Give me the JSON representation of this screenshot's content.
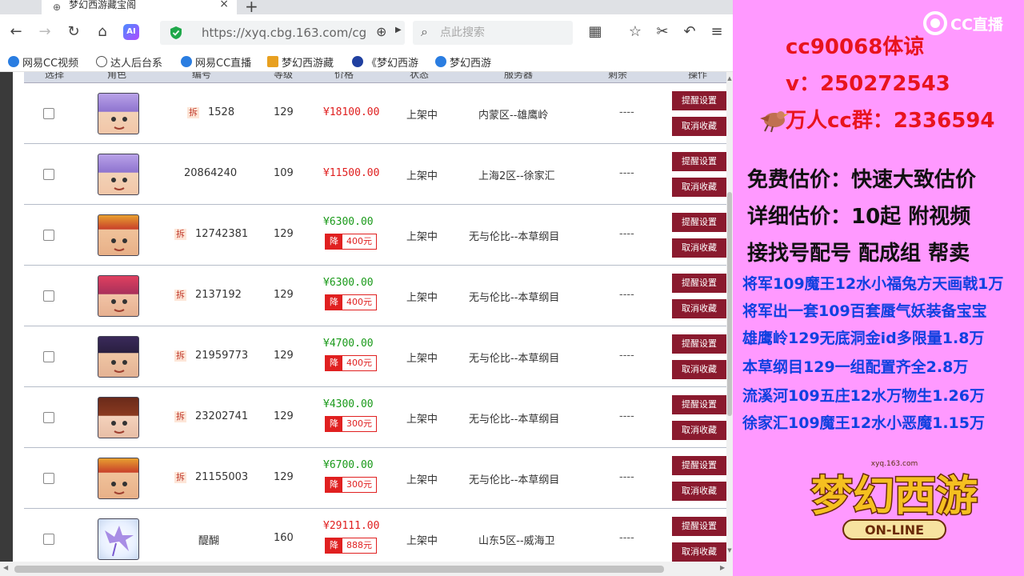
{
  "browser": {
    "tab_title": "梦幻西游藏宝阁",
    "address_url": "https://xyq.cbg.163.com/cg",
    "search_placeholder": "点此搜索",
    "ai_label": "AI",
    "bookmarks": [
      {
        "label": "网易CC视频",
        "color": "#2a7de1"
      },
      {
        "label": "达人后台系",
        "color": "#555555"
      },
      {
        "label": "网易CC直播",
        "color": "#2a7de1"
      },
      {
        "label": "梦幻西游藏",
        "color": "#e8a020"
      },
      {
        "label": "《梦幻西游",
        "color": "#2040a0"
      },
      {
        "label": "梦幻西游",
        "color": "#2a7de1"
      }
    ]
  },
  "table": {
    "headers": [
      "选择",
      "角色",
      "编号",
      "等级",
      "价格",
      "状态",
      "服务器",
      "剩余",
      "操作"
    ],
    "split_badge": "拆",
    "btn_remind": "提醒设置",
    "btn_cancel": "取消收藏",
    "rows": [
      {
        "avatar": "purple-hair",
        "split": true,
        "id": "1528",
        "level": "129",
        "price": "¥18100.00",
        "price_color": "red",
        "drop": null,
        "status": "上架中",
        "server": "内蒙区--雄鹰岭",
        "remain": "----"
      },
      {
        "avatar": "purple-hair",
        "split": false,
        "id": "20864240",
        "level": "109",
        "price": "¥11500.00",
        "price_color": "red",
        "drop": null,
        "status": "上架中",
        "server": "上海2区--徐家汇",
        "remain": "----"
      },
      {
        "avatar": "crown-boy",
        "split": true,
        "id": "12742381",
        "level": "129",
        "price": "¥6300.00",
        "price_color": "green",
        "drop": "400元",
        "status": "上架中",
        "server": "无与伦比--本草纲目",
        "remain": "----"
      },
      {
        "avatar": "red-hair",
        "split": true,
        "id": "2137192",
        "level": "129",
        "price": "¥6300.00",
        "price_color": "green",
        "drop": "400元",
        "status": "上架中",
        "server": "无与伦比--本草纲目",
        "remain": "----"
      },
      {
        "avatar": "dark-hair",
        "split": true,
        "id": "21959773",
        "level": "129",
        "price": "¥4700.00",
        "price_color": "green",
        "drop": "400元",
        "status": "上架中",
        "server": "无与伦比--本草纲目",
        "remain": "----"
      },
      {
        "avatar": "girl",
        "split": true,
        "id": "23202741",
        "level": "129",
        "price": "¥4300.00",
        "price_color": "green",
        "drop": "300元",
        "status": "上架中",
        "server": "无与伦比--本草纲目",
        "remain": "----"
      },
      {
        "avatar": "crown-boy",
        "split": true,
        "id": "21155003",
        "level": "129",
        "price": "¥6700.00",
        "price_color": "green",
        "drop": "300元",
        "status": "上架中",
        "server": "无与伦比--本草纲目",
        "remain": "----"
      },
      {
        "avatar": "butterfly",
        "split": false,
        "id": "醍醐",
        "level": "160",
        "price": "¥29111.00",
        "price_color": "red",
        "drop": "888元",
        "status": "上架中",
        "server": "山东5区--威海卫",
        "remain": "----"
      }
    ],
    "drop_label": "降"
  },
  "overlay": {
    "cc_brand": "CC直播",
    "line1": "cc90068体谅",
    "line2": "v：250272543",
    "line3": "万人cc群：2336594",
    "service1": "免费估价：快速大致估价",
    "service2": "详细估价：10起  附视频",
    "service3": "接找号配号 配成组 帮卖",
    "listings": [
      "将军109魔王12水小福兔方天画戟1万",
      "将军出一套109百套蜃气妖装备宝宝",
      "雄鹰岭129无底洞金id多限量1.8万",
      "本草纲目129一组配置齐全2.8万",
      "流溪河109五庄12水万物生1.26万",
      "徐家汇109魔王12水小恶魔1.15万"
    ],
    "game_logo_text": "梦幻西游",
    "game_logo_sub": "ON-LINE",
    "game_logo_url": "xyq.163.com"
  }
}
